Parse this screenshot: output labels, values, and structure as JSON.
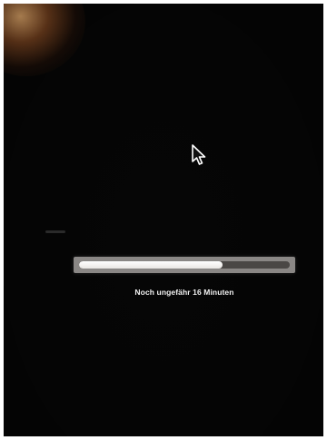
{
  "screen": {
    "background_color": "#060606",
    "glare_color": "#ffbe78"
  },
  "cursor": {
    "icon": "arrow-pointer-icon",
    "color": "#ffffff"
  },
  "progress": {
    "fraction": 0.68,
    "track_color": "#8a8785",
    "fill_color": "#ffffff"
  },
  "status": {
    "text": "Noch ungefähr 16 Minuten"
  }
}
